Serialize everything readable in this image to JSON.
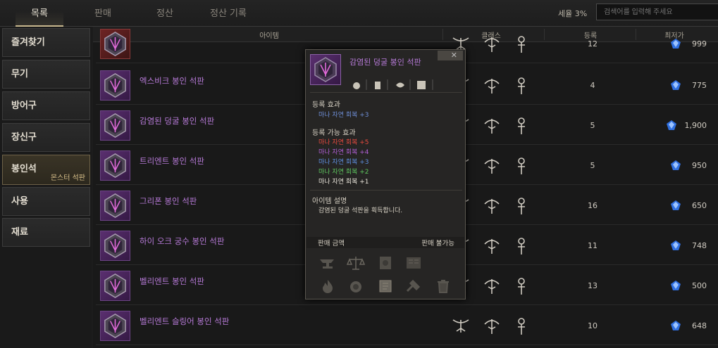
{
  "tabs": {
    "list": "목록",
    "sell": "판매",
    "settle": "정산",
    "history": "정산 기록"
  },
  "tax": "세율 3%",
  "search": {
    "placeholder": "검색어를 입력해 주세요"
  },
  "sidebar": {
    "items": [
      {
        "label": "즐겨찾기"
      },
      {
        "label": "무기"
      },
      {
        "label": "방어구"
      },
      {
        "label": "장신구"
      },
      {
        "label": "봉인석"
      },
      {
        "label": "사용"
      },
      {
        "label": "재료"
      }
    ],
    "sub": "몬스터 석판"
  },
  "columns": {
    "item": "아이템",
    "class": "클래스",
    "level": "등록",
    "price": "최저가"
  },
  "rows": [
    {
      "name": "",
      "level": "12",
      "price": "999"
    },
    {
      "name": "엑스비크 봉인 석판",
      "level": "4",
      "price": "775"
    },
    {
      "name": "감염된 덩굴 봉인 석판",
      "level": "5",
      "price": "1,900"
    },
    {
      "name": "트리엔트 봉인 석판",
      "level": "5",
      "price": "950"
    },
    {
      "name": "그리폰 봉인 석판",
      "level": "16",
      "price": "650"
    },
    {
      "name": "하이 오크 궁수 봉인 석판",
      "level": "11",
      "price": "748"
    },
    {
      "name": "벨리엔트 봉인 석판",
      "level": "13",
      "price": "500"
    },
    {
      "name": "벨리엔트 슬링어 봉인 석판",
      "level": "10",
      "price": "648"
    }
  ],
  "tooltip": {
    "title": "감염된 덩굴 봉인 석판",
    "close": "✕",
    "reg_effect_title": "등록 효과",
    "reg_effect": "마나 자연 회복 +3",
    "possible_title": "등록 가능 효과",
    "possible": [
      {
        "text": "마나 자연 회복 +5",
        "color": "#e84a3f"
      },
      {
        "text": "마나 자연 회복 +4",
        "color": "#b15fd6"
      },
      {
        "text": "마나 자연 회복 +3",
        "color": "#5f8fe0"
      },
      {
        "text": "마나 자연 회복 +2",
        "color": "#5fc65f"
      },
      {
        "text": "마나 자연 회복 +1",
        "color": "#e8e4da"
      }
    ],
    "desc_title": "아이템 설명",
    "desc": "감염된 덩굴 석판을 획득합니다.",
    "sell_label": "판매 금액",
    "sell_value": "판매 불가능"
  },
  "colors": {
    "accent": "#c9b98f",
    "item_name": "#b77ad8",
    "stat_blue": "#6f8fd8"
  }
}
